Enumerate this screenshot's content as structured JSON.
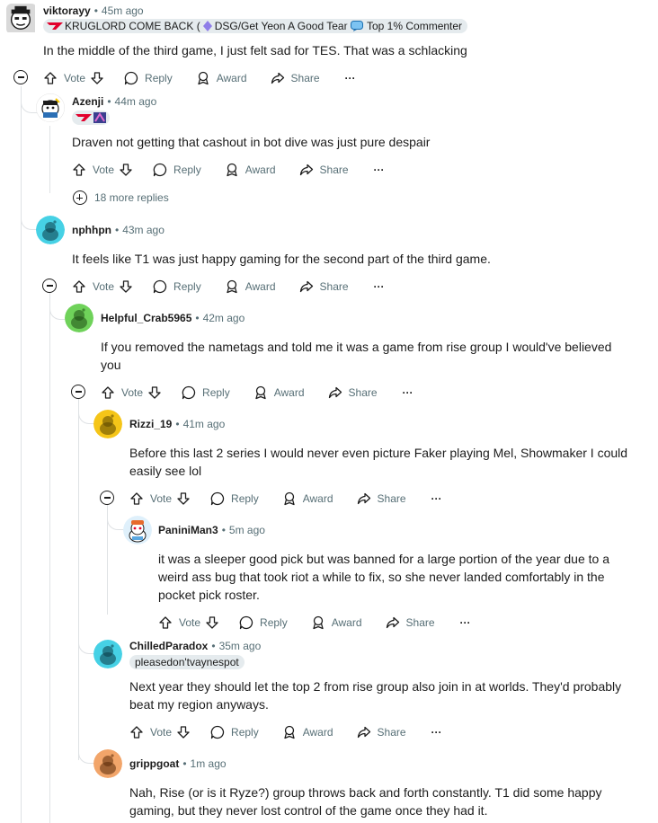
{
  "actions": {
    "vote": "Vote",
    "reply": "Reply",
    "award": "Award",
    "share": "Share",
    "more": "···"
  },
  "comments": [
    {
      "username": "viktorayy",
      "time": "45m ago",
      "flair_text": "KRUGLORD COME BACK (",
      "flair_text2": "DSG/Get Yeon A Good Team)",
      "badge": "Top 1% Commenter",
      "body": "In the middle of the third game, I just felt sad for TES. That was a schlacking",
      "avatar_color": "#d6d6d6"
    },
    {
      "username": "Azenji",
      "time": "44m ago",
      "body": "Draven not getting that cashout in bot dive was just pure despair",
      "more_replies": "18 more replies",
      "avatar_color": "#ffffff"
    },
    {
      "username": "nphhpn",
      "time": "43m ago",
      "body": "It feels like T1 was just happy gaming for the second part of the third game.",
      "avatar_color": "#46d1e5"
    },
    {
      "username": "Helpful_Crab5965",
      "time": "42m ago",
      "body1": "If you removed the nametags and told me it was a game from rise group I would've believed",
      "body2": "you",
      "avatar_color": "#6fd25a"
    },
    {
      "username": "Rizzi_19",
      "time": "41m ago",
      "body1": "Before this last 2 series I would never even picture Faker playing Mel, Showmaker I could",
      "body2": "easily see lol",
      "avatar_color": "#f5c518"
    },
    {
      "username": "PaniniMan3",
      "time": "5m ago",
      "body1": "it was a sleeper good pick but was banned for a large portion of the year due to a",
      "body2": "weird ass bug that took riot a while to fix, so she never landed comfortably in the",
      "body3": "pocket pick roster.",
      "avatar_color": "#5aa7e0"
    },
    {
      "username": "ChilledParadox",
      "time": "35m ago",
      "flair_text": "pleasedon'tvaynespot",
      "body1": "Next year they should let the top 2 from rise group also join in at worlds. They'd probably",
      "body2": "beat my region anyways.",
      "avatar_color": "#46d1e5"
    },
    {
      "username": "grippgoat",
      "time": "1m ago",
      "body1": "Nah, Rise (or is it Ryze?) group throws back and forth constantly. T1 did some happy",
      "body2": "gaming, but they never lost control of the game once they had it.",
      "avatar_color": "#f2a56a"
    }
  ]
}
